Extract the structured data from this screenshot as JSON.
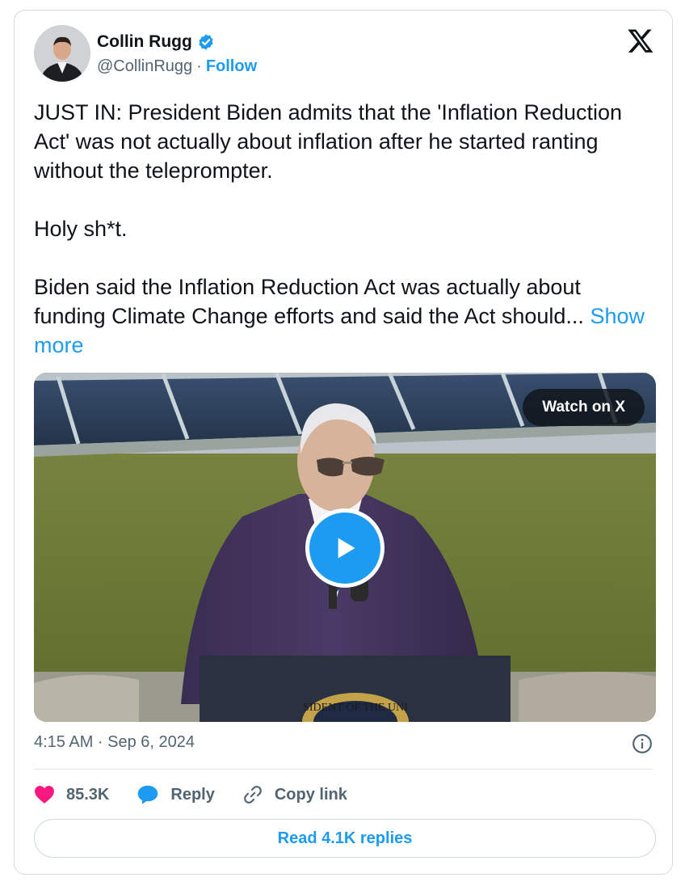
{
  "author": {
    "name": "Collin Rugg",
    "handle": "@CollinRugg",
    "separator": "·",
    "follow_label": "Follow"
  },
  "tweet": {
    "paragraphs": [
      "JUST IN: President Biden admits that the 'Inflation Reduction Act' was not actually about inflation after he started ranting without the teleprompter.",
      "Holy sh*t.",
      "Biden said the Inflation Reduction Act was actually about funding Climate Change efforts and said the Act should..."
    ],
    "show_more_label": "Show more"
  },
  "media": {
    "watch_label": "Watch on X",
    "seal_text": "SIDENT OF THE UNI"
  },
  "timestamp": "4:15 AM · Sep 6, 2024",
  "actions": {
    "likes_count": "85.3K",
    "reply_label": "Reply",
    "copy_link_label": "Copy link"
  },
  "read_replies_label": "Read 4.1K replies",
  "colors": {
    "accent": "#1d9bf0",
    "like": "#f91880",
    "text_secondary": "#536471"
  },
  "icons": [
    "verified-badge-icon",
    "x-logo-icon",
    "play-icon",
    "info-icon",
    "heart-icon",
    "reply-icon",
    "link-icon"
  ]
}
